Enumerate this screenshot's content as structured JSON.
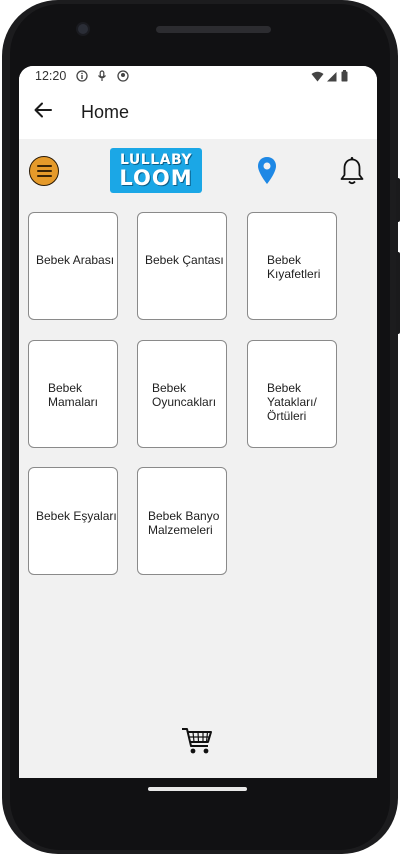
{
  "status_bar": {
    "time": "12:20"
  },
  "app_bar": {
    "title": "Home"
  },
  "brand": {
    "logo_line1": "LULLABY",
    "logo_line2": "LOOM"
  },
  "categories": [
    {
      "label": "Bebek Arabası"
    },
    {
      "label": "Bebek Çantası"
    },
    {
      "label": "Bebek\nKıyafetleri"
    },
    {
      "label": "Bebek\nMamaları"
    },
    {
      "label": "Bebek\nOyuncakları"
    },
    {
      "label": "Bebek\nYatakları/\nÖrtüleri"
    },
    {
      "label": "Bebek Eşyaları"
    },
    {
      "label": "Bebek Banyo\nMalzemeleri"
    }
  ],
  "icons": {
    "menu": "menu-icon",
    "location": "location-pin-icon",
    "notifications": "bell-icon",
    "cart": "shopping-cart-icon",
    "back": "back-arrow-icon"
  },
  "colors": {
    "logo_background": "#1ba7e6",
    "menu_button": "#e59a2a",
    "location_pin": "#1e88e5",
    "screen_background": "#f1f1f1"
  }
}
